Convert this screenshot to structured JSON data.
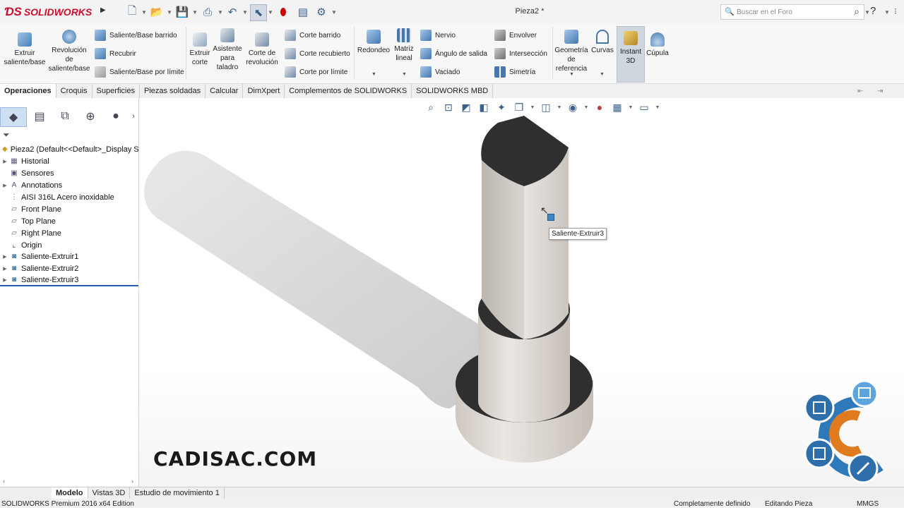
{
  "app": {
    "brand": "SOLIDWORKS",
    "document_title": "Pieza2 *"
  },
  "search": {
    "placeholder": "Buscar en el Foro"
  },
  "help_label": "?",
  "ribbon": {
    "buttons": {
      "extruir": "Extruir saliente/base",
      "revolucion": "Revolución de saliente/base",
      "saliente_barrido": "Saliente/Base barrido",
      "recubrir": "Recubrir",
      "saliente_limite": "Saliente/Base por límite",
      "extruir_corte": "Extruir corte",
      "asistente": "Asistente para taladro",
      "corte_revolucion": "Corte de revolución",
      "corte_barrido": "Corte barrido",
      "corte_recubierto": "Corte recubierto",
      "corte_limite": "Corte por límite",
      "redondeo": "Redondeo",
      "matriz": "Matriz lineal",
      "nervio": "Nervio",
      "angulo": "Ángulo de salida",
      "vaciado": "Vaciado",
      "envolver": "Envolver",
      "interseccion": "Intersección",
      "simetria": "Simetría",
      "geometria": "Geometría de referencia",
      "curvas": "Curvas",
      "instant3d": "Instant 3D",
      "cupula": "Cúpula"
    }
  },
  "tabs": [
    "Operaciones",
    "Croquis",
    "Superficies",
    "Piezas soldadas",
    "Calcular",
    "DimXpert",
    "Complementos de SOLIDWORKS",
    "SOLIDWORKS MBD"
  ],
  "tree": {
    "root": "Pieza2  (Default<<Default>_Display S",
    "items": [
      "Historial",
      "Sensores",
      "Annotations",
      "AISI 316L Acero inoxidable",
      "Front Plane",
      "Top Plane",
      "Right Plane",
      "Origin",
      "Saliente-Extruir1",
      "Saliente-Extruir2",
      "Saliente-Extruir3"
    ]
  },
  "viewport": {
    "tooltip": "Saliente-Extruir3",
    "watermark": "CADISAC.COM"
  },
  "bottom_tabs": [
    "Modelo",
    "Vistas 3D",
    "Estudio de movimiento 1"
  ],
  "status": {
    "edition": "SOLIDWORKS Premium 2016 x64 Edition",
    "definition": "Completamente definido",
    "mode": "Editando Pieza",
    "units": "MMGS"
  },
  "colors": {
    "brand_red": "#c8102e",
    "selection_blue": "#2a5db0",
    "part_gray": "#d8d4cf"
  }
}
